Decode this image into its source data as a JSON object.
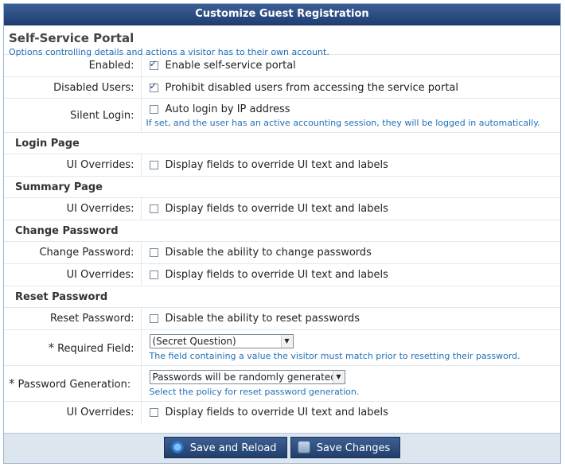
{
  "window": {
    "title": "Customize Guest Registration"
  },
  "section": {
    "title": "Self-Service Portal",
    "description": "Options controlling details and actions a visitor has to their own account."
  },
  "fields": {
    "enabled": {
      "label": "Enabled:",
      "checkbox_label": "Enable self-service portal",
      "checked": true
    },
    "disabled_users": {
      "label": "Disabled Users:",
      "checkbox_label": "Prohibit disabled users from accessing the service portal",
      "checked": true
    },
    "silent_login": {
      "label": "Silent Login:",
      "checkbox_label": "Auto login by IP address",
      "checked": false,
      "hint": "If set, and the user has an active accounting session, they will be logged in automatically."
    }
  },
  "login_page": {
    "heading": "Login Page",
    "ui_overrides": {
      "label": "UI Overrides:",
      "checkbox_label": "Display fields to override UI text and labels",
      "checked": false
    }
  },
  "summary_page": {
    "heading": "Summary Page",
    "ui_overrides": {
      "label": "UI Overrides:",
      "checkbox_label": "Display fields to override UI text and labels",
      "checked": false
    }
  },
  "change_password": {
    "heading": "Change Password",
    "change_password": {
      "label": "Change Password:",
      "checkbox_label": "Disable the ability to change passwords",
      "checked": false
    },
    "ui_overrides": {
      "label": "UI Overrides:",
      "checkbox_label": "Display fields to override UI text and labels",
      "checked": false
    }
  },
  "reset_password": {
    "heading": "Reset Password",
    "reset_password": {
      "label": "Reset Password:",
      "checkbox_label": "Disable the ability to reset passwords",
      "checked": false
    },
    "required_field": {
      "required_mark": "*",
      "label": "Required Field:",
      "value": "(Secret Question)",
      "hint": "The field containing a value the visitor must match prior to resetting their password."
    },
    "password_generation": {
      "required_mark": "*",
      "label": "Password Generation:",
      "value": "Passwords will be randomly generated",
      "hint": "Select the policy for reset password generation."
    },
    "ui_overrides": {
      "label": "UI Overrides:",
      "checkbox_label": "Display fields to override UI text and labels",
      "checked": false
    }
  },
  "buttons": {
    "save_reload": {
      "label": "Save and Reload",
      "icon": "reload-icon"
    },
    "save_changes": {
      "label": "Save Changes",
      "icon": "save-icon"
    }
  },
  "colors": {
    "titlebar": "#2b4c80",
    "link_hint": "#1f6fb8",
    "footer": "#dde6ef"
  }
}
